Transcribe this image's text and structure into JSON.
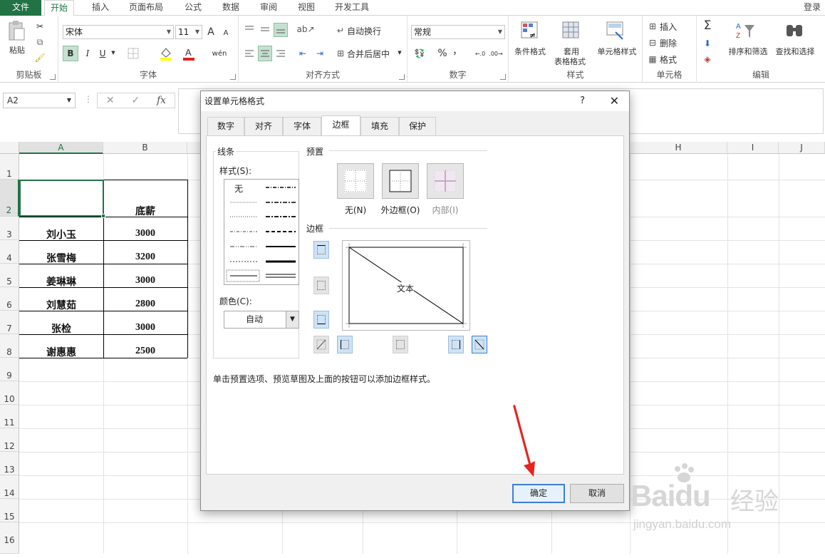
{
  "ribbon_tabs": {
    "file": "文件",
    "home": "开始",
    "insert": "插入",
    "page_layout": "页面布局",
    "formulas": "公式",
    "data": "数据",
    "review": "审阅",
    "view": "视图",
    "developer": "开发工具",
    "login": "登录"
  },
  "clipboard": {
    "paste": "粘贴",
    "label": "剪贴板"
  },
  "font_group": {
    "font_name": "宋体",
    "font_size": "11",
    "bold": "B",
    "italic": "I",
    "underline": "U",
    "grow": "A",
    "shrink": "A",
    "label": "字体",
    "phonetic": "wén"
  },
  "align_group": {
    "wrap": "自动换行",
    "merge": "合并后居中",
    "label": "对齐方式"
  },
  "number_group": {
    "format": "常规",
    "percent": "%",
    "comma": "，",
    "label": "数字"
  },
  "styles_group": {
    "cond": "条件格式",
    "table1": "套用",
    "table2": "表格格式",
    "cell": "单元格样式",
    "label": "样式"
  },
  "cells_group": {
    "insert": "插入",
    "delete": "删除",
    "format": "格式",
    "label": "单元格"
  },
  "editing_group": {
    "sort": "排序和筛选",
    "find": "查找和选择",
    "label": "编辑",
    "sum": "Σ"
  },
  "formula_bar": {
    "namebox": "A2",
    "cancel": "✕",
    "enter": "✓",
    "fx": "fx"
  },
  "columns": [
    "A",
    "B",
    "H",
    "I",
    "J"
  ],
  "rows": [
    "1",
    "2",
    "3",
    "4",
    "5",
    "6",
    "7",
    "8",
    "9",
    "10",
    "11",
    "12",
    "13",
    "14",
    "15",
    "16"
  ],
  "sheet": {
    "header_b": "底薪",
    "names": [
      "刘小玉",
      "张雪梅",
      "姜琳琳",
      "刘慧茹",
      "张检",
      "谢惠惠"
    ],
    "salaries": [
      "3000",
      "3200",
      "3000",
      "2800",
      "3000",
      "2500"
    ]
  },
  "dialog": {
    "title": "设置单元格格式",
    "help": "?",
    "close": "✕",
    "tabs": [
      "数字",
      "对齐",
      "字体",
      "边框",
      "填充",
      "保护"
    ],
    "line_label": "线条",
    "style_label": "样式(S):",
    "style_none": "无",
    "color_label": "颜色(C):",
    "color_value": "自动",
    "preset_label": "预置",
    "preset_none": "无(N)",
    "preset_outline": "外边框(O)",
    "preset_inside": "内部(I)",
    "border_label": "边框",
    "preview_text": "文本",
    "hint": "单击预置选项、预览草图及上面的按钮可以添加边框样式。",
    "ok": "确定",
    "cancel": "取消"
  },
  "watermark": {
    "brand": "Bai",
    "brand2": "du",
    "cn": "经验",
    "url": "jingyan.baidu.com"
  },
  "colors": {
    "excel_green": "#217346",
    "arrow_red": "#e8231f",
    "ok_border": "#3c7fd5"
  }
}
